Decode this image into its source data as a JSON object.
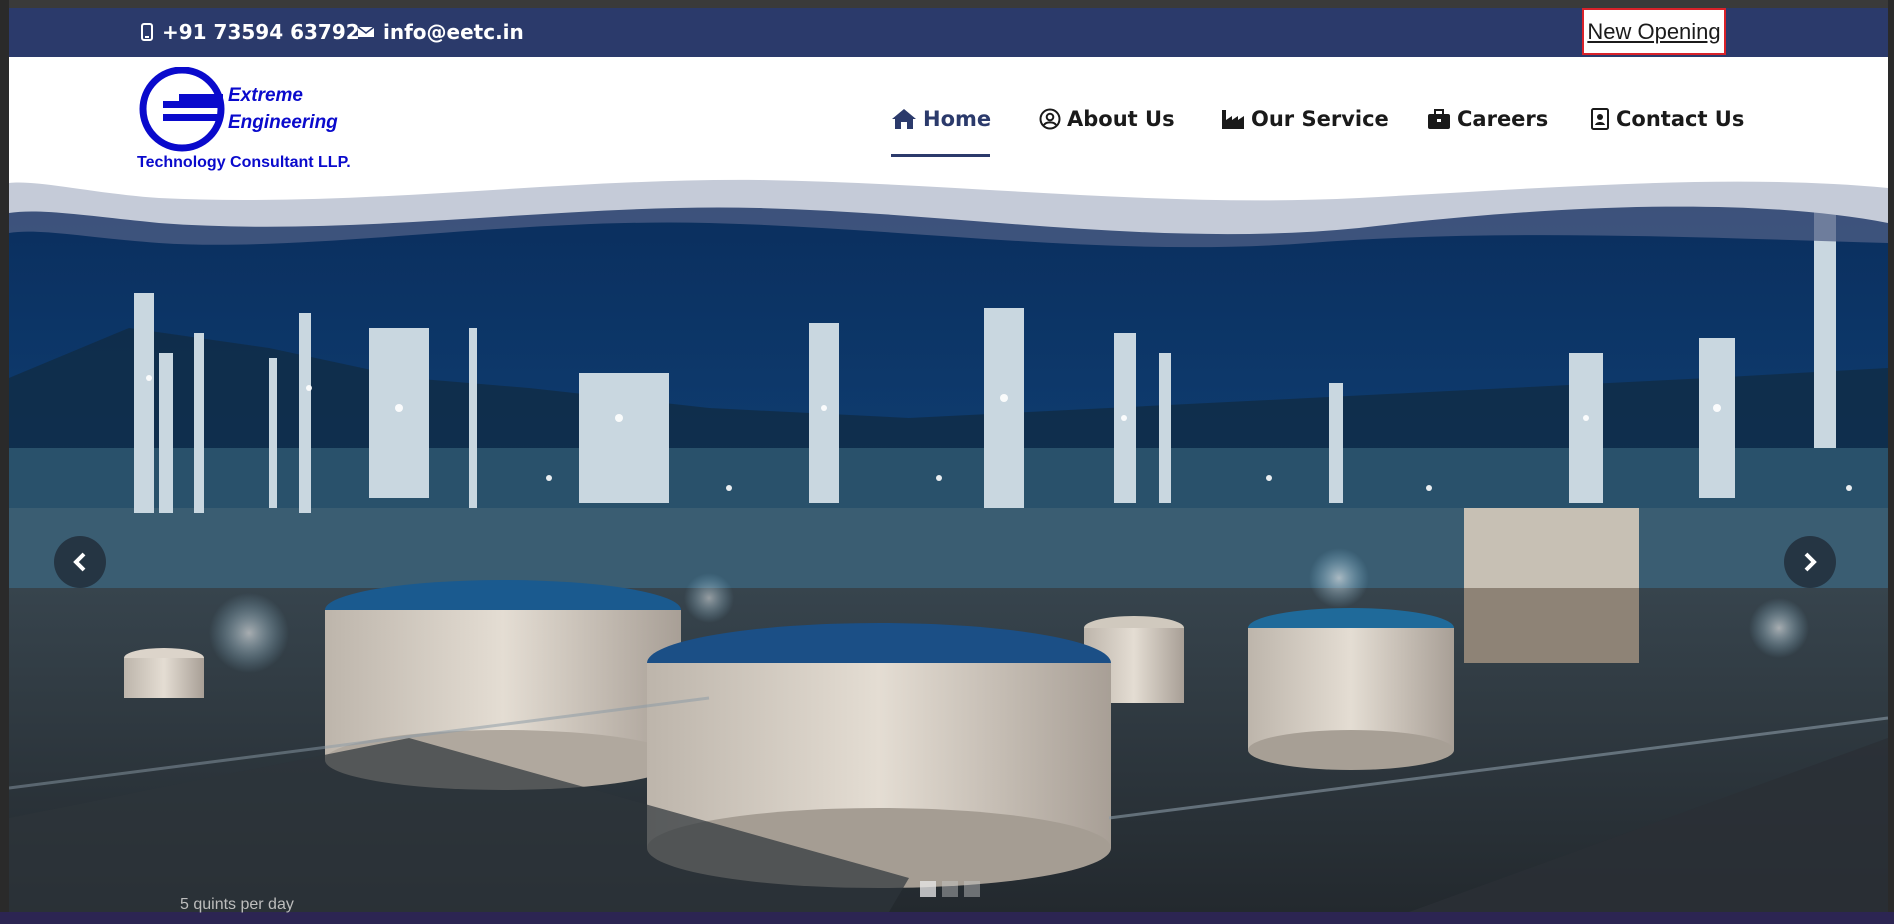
{
  "topbar": {
    "phone": "+91 73594 63792",
    "email": "info@eetc.in",
    "new_opening": "New Opening",
    "icons": {
      "phone": "mobile-phone-icon",
      "email": "envelope-icon"
    },
    "colors": {
      "bar": "#2b3a6b",
      "highlight_border": "#d9222a"
    }
  },
  "logo": {
    "line1": "Extreme",
    "line2": "Engineering",
    "line3": "Technology Consultant LLP.",
    "color": "#0a0acc"
  },
  "nav": {
    "items": [
      {
        "label": "Home",
        "icon": "home-icon",
        "active": true
      },
      {
        "label": "About Us",
        "icon": "user-circle-icon",
        "active": false
      },
      {
        "label": "Our Service",
        "icon": "industry-icon",
        "active": false
      },
      {
        "label": "Careers",
        "icon": "briefcase-icon",
        "active": false
      },
      {
        "label": "Contact Us",
        "icon": "address-card-icon",
        "active": false
      }
    ]
  },
  "hero": {
    "slide_count": 3,
    "active_slide": 1,
    "prev_icon": "chevron-left-icon",
    "next_icon": "chevron-right-icon"
  },
  "below_fold": {
    "partial_text": "5 quints per day"
  }
}
